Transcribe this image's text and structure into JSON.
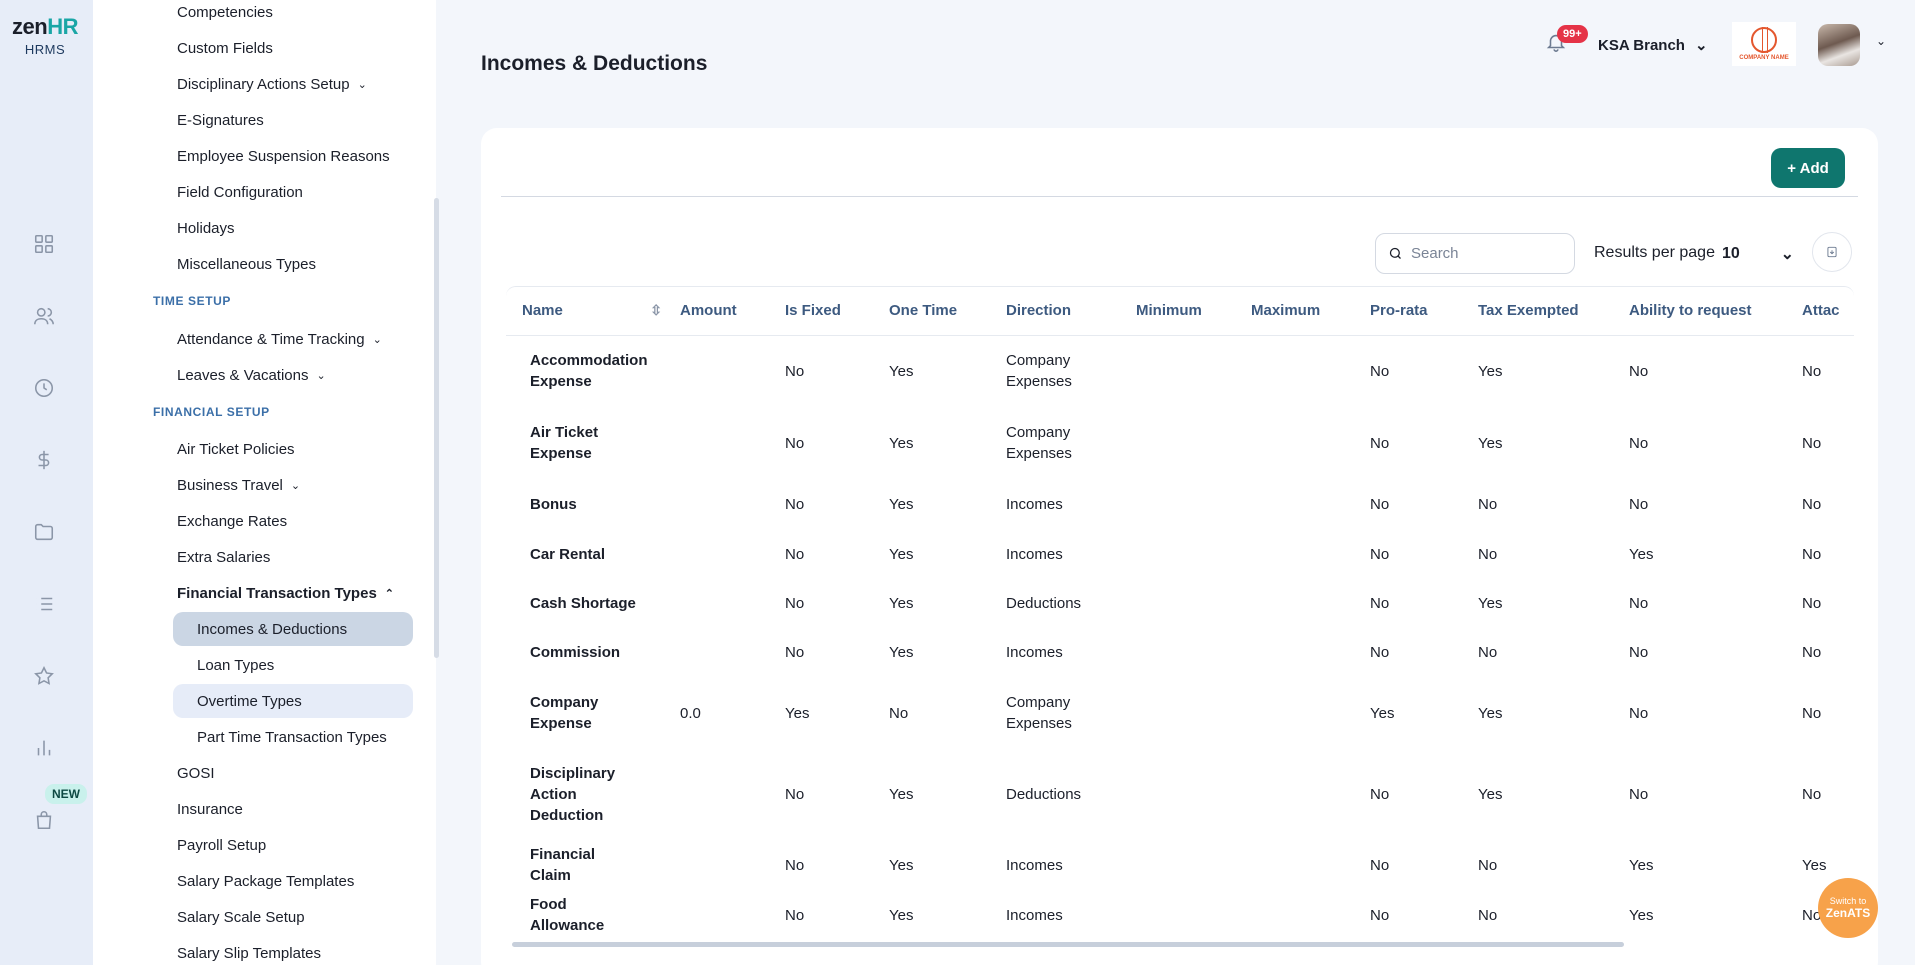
{
  "brand": {
    "logo_main": "zen",
    "logo_accent": "HR",
    "product": "HRMS",
    "new_badge": "NEW"
  },
  "rail_icons": [
    "grid-icon",
    "users-icon",
    "clock-icon",
    "dollar-icon",
    "folder-icon",
    "list-icon",
    "star-icon",
    "chart-icon",
    "bag-icon"
  ],
  "sidebar": {
    "top_items": [
      {
        "label": "Competencies"
      },
      {
        "label": "Custom Fields"
      },
      {
        "label": "Disciplinary Actions Setup",
        "chevron": "down"
      },
      {
        "label": "E-Signatures"
      },
      {
        "label": "Employee Suspension Reasons"
      },
      {
        "label": "Field Configuration"
      },
      {
        "label": "Holidays"
      },
      {
        "label": "Miscellaneous Types"
      }
    ],
    "time_section": "TIME SETUP",
    "time_items": [
      {
        "label": "Attendance & Time Tracking",
        "chevron": "down"
      },
      {
        "label": "Leaves & Vacations",
        "chevron": "down"
      }
    ],
    "financial_section": "FINANCIAL SETUP",
    "financial_items": [
      {
        "label": "Air Ticket Policies"
      },
      {
        "label": "Business Travel",
        "chevron": "down"
      },
      {
        "label": "Exchange Rates"
      },
      {
        "label": "Extra Salaries"
      },
      {
        "label": "Financial Transaction Types",
        "chevron": "up"
      }
    ],
    "sub_items": [
      {
        "label": "Incomes & Deductions",
        "state": "active"
      },
      {
        "label": "Loan Types",
        "state": ""
      },
      {
        "label": "Overtime Types",
        "state": "hover"
      },
      {
        "label": "Part Time Transaction Types",
        "state": ""
      }
    ],
    "bottom_items": [
      {
        "label": "GOSI"
      },
      {
        "label": "Insurance"
      },
      {
        "label": "Payroll Setup"
      },
      {
        "label": "Salary Package Templates"
      },
      {
        "label": "Salary Scale Setup"
      },
      {
        "label": "Salary Slip Templates"
      }
    ]
  },
  "header": {
    "title": "Incomes & Deductions",
    "notification_count": "99+",
    "branch": "KSA Branch",
    "company_logo_text": "COMPANY NAME"
  },
  "toolbar": {
    "add_label": "+ Add",
    "search_placeholder": "Search",
    "results_per_page_label": "Results per page",
    "results_per_page_value": "10"
  },
  "table": {
    "columns": [
      "Name",
      "Amount",
      "Is Fixed",
      "One Time",
      "Direction",
      "Minimum",
      "Maximum",
      "Pro-rata",
      "Tax Exempted",
      "Ability to request",
      "Attac"
    ],
    "rows": [
      {
        "name": "Accommodation Expense",
        "amount": "",
        "is_fixed": "No",
        "one_time": "Yes",
        "direction": "Company Expenses",
        "minimum": "",
        "maximum": "",
        "pro_rata": "No",
        "tax_exempted": "Yes",
        "ability": "No",
        "attach": "No"
      },
      {
        "name": "Air Ticket Expense",
        "amount": "",
        "is_fixed": "No",
        "one_time": "Yes",
        "direction": "Company Expenses",
        "minimum": "",
        "maximum": "",
        "pro_rata": "No",
        "tax_exempted": "Yes",
        "ability": "No",
        "attach": "No"
      },
      {
        "name": "Bonus",
        "amount": "",
        "is_fixed": "No",
        "one_time": "Yes",
        "direction": "Incomes",
        "minimum": "",
        "maximum": "",
        "pro_rata": "No",
        "tax_exempted": "No",
        "ability": "No",
        "attach": "No"
      },
      {
        "name": "Car Rental",
        "amount": "",
        "is_fixed": "No",
        "one_time": "Yes",
        "direction": "Incomes",
        "minimum": "",
        "maximum": "",
        "pro_rata": "No",
        "tax_exempted": "No",
        "ability": "Yes",
        "attach": "No"
      },
      {
        "name": "Cash Shortage",
        "amount": "",
        "is_fixed": "No",
        "one_time": "Yes",
        "direction": "Deductions",
        "minimum": "",
        "maximum": "",
        "pro_rata": "No",
        "tax_exempted": "Yes",
        "ability": "No",
        "attach": "No"
      },
      {
        "name": "Commission",
        "amount": "",
        "is_fixed": "No",
        "one_time": "Yes",
        "direction": "Incomes",
        "minimum": "",
        "maximum": "",
        "pro_rata": "No",
        "tax_exempted": "No",
        "ability": "No",
        "attach": "No"
      },
      {
        "name": "Company Expense",
        "amount": "0.0",
        "is_fixed": "Yes",
        "one_time": "No",
        "direction": "Company Expenses",
        "minimum": "",
        "maximum": "",
        "pro_rata": "Yes",
        "tax_exempted": "Yes",
        "ability": "No",
        "attach": "No"
      },
      {
        "name": "Disciplinary Action Deduction",
        "amount": "",
        "is_fixed": "No",
        "one_time": "Yes",
        "direction": "Deductions",
        "minimum": "",
        "maximum": "",
        "pro_rata": "No",
        "tax_exempted": "Yes",
        "ability": "No",
        "attach": "No"
      },
      {
        "name": "Financial Claim",
        "amount": "",
        "is_fixed": "No",
        "one_time": "Yes",
        "direction": "Incomes",
        "minimum": "",
        "maximum": "",
        "pro_rata": "No",
        "tax_exempted": "No",
        "ability": "Yes",
        "attach": "Yes"
      },
      {
        "name": "Food Allowance",
        "amount": "",
        "is_fixed": "No",
        "one_time": "Yes",
        "direction": "Incomes",
        "minimum": "",
        "maximum": "",
        "pro_rata": "No",
        "tax_exempted": "No",
        "ability": "Yes",
        "attach": "No"
      }
    ]
  },
  "zenats": {
    "line1": "Switch to",
    "line2": "ZenATS"
  },
  "colors": {
    "accent": "#0f766e",
    "badge": "#e53347",
    "zenats": "#f7a24a",
    "header_text": "#3d5a80"
  }
}
